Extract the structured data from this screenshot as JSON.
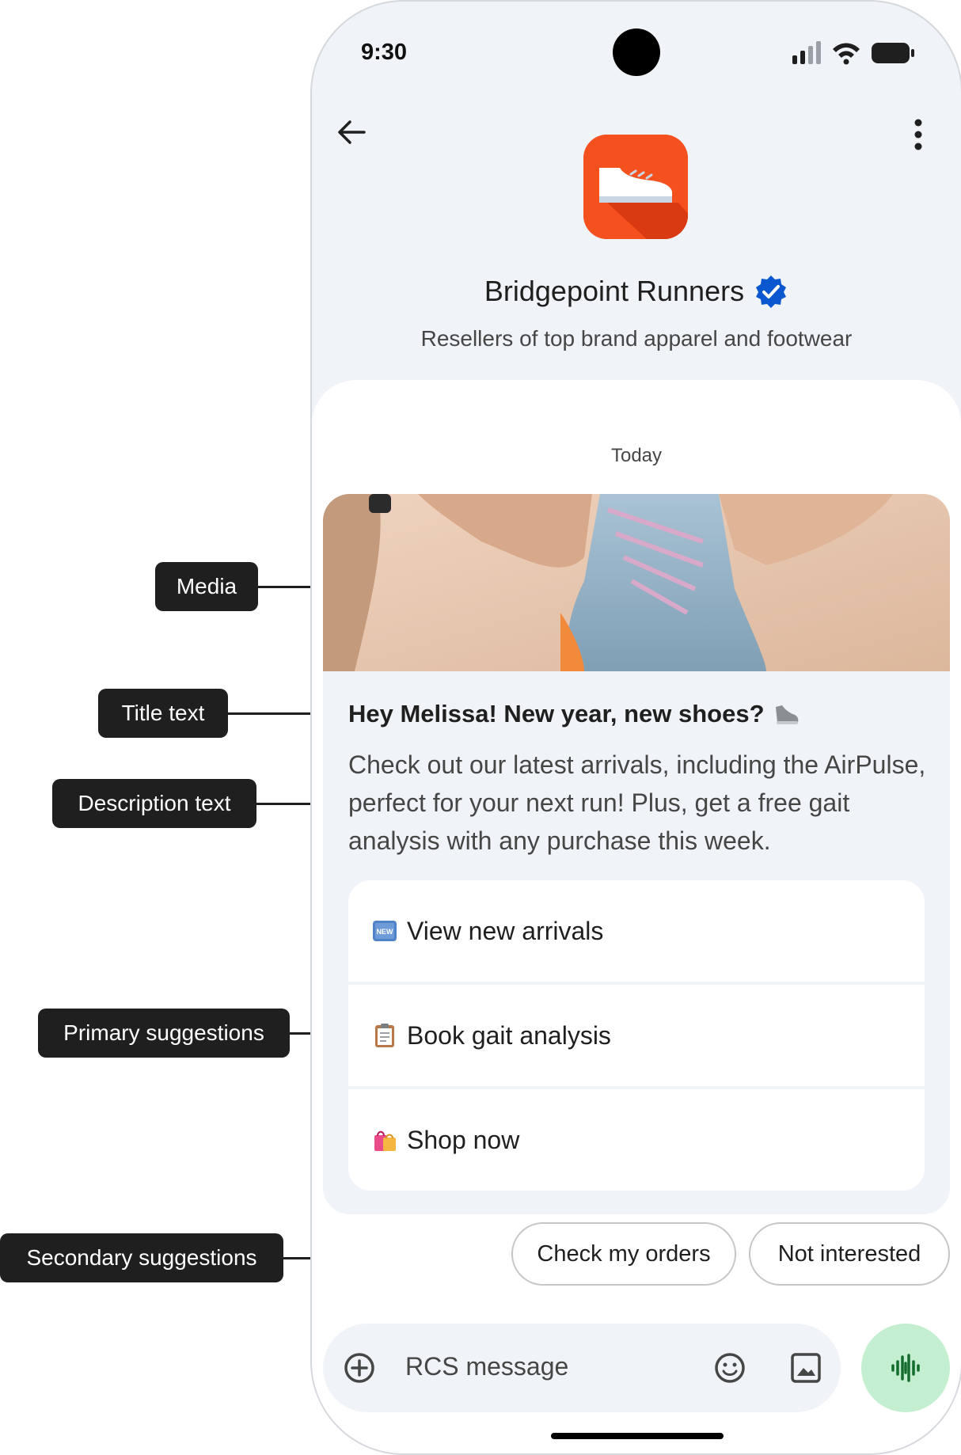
{
  "annotations": {
    "media": "Media",
    "title_text": "Title text",
    "description_text": "Description text",
    "primary_suggestions": "Primary suggestions",
    "secondary_suggestions": "Secondary suggestions"
  },
  "status_bar": {
    "time": "9:30"
  },
  "header": {
    "brand_name": "Bridgepoint Runners",
    "tagline": "Resellers of top brand apparel and footwear",
    "verified_color": "#0b57d0",
    "logo_color": "#f4511e"
  },
  "conversation": {
    "date_label": "Today"
  },
  "rich_card": {
    "title": "Hey Melissa! New year, new shoes?",
    "description": "Check out our latest arrivals, including the AirPulse, perfect for your next run! Plus, get a free gait analysis with any purchase this week.",
    "suggestions": [
      {
        "icon": "new-emoji-icon",
        "label": "View new arrivals"
      },
      {
        "icon": "clipboard-emoji-icon",
        "label": "Book gait analysis"
      },
      {
        "icon": "shopping-bags-emoji-icon",
        "label": "Shop now"
      }
    ]
  },
  "secondary_suggestions": [
    {
      "label": "Check my orders"
    },
    {
      "label": "Not interested"
    }
  ],
  "composer": {
    "placeholder": "RCS message",
    "mic_color": "#c4eed0",
    "mic_icon_color": "#146c2e"
  }
}
